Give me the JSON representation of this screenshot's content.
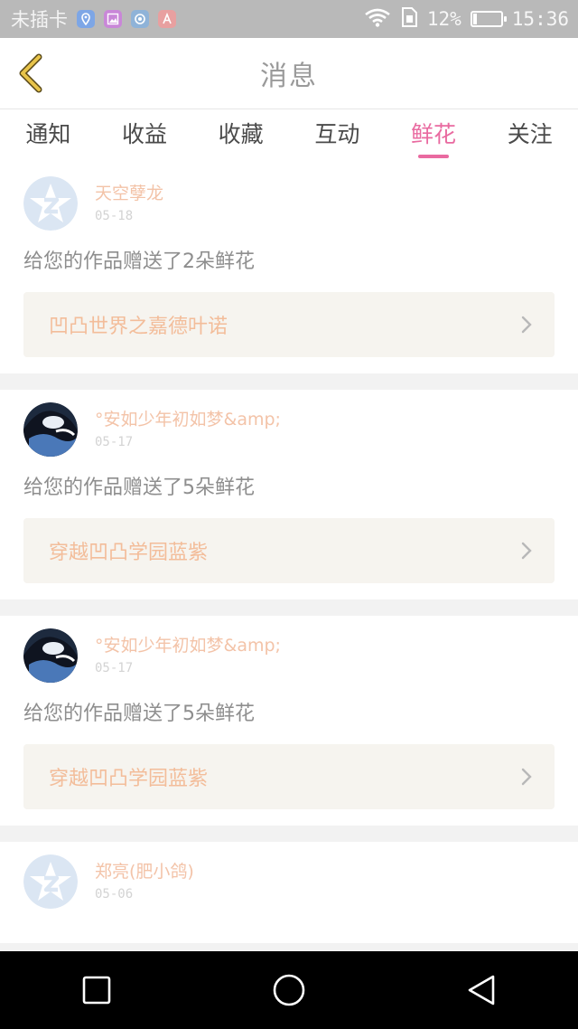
{
  "status_bar": {
    "carrier": "未插卡",
    "battery_percent": "12%",
    "battery_level": 0.12,
    "time": "15:36",
    "icons": [
      "location-icon",
      "gallery-icon",
      "app-icon",
      "app-icon-a"
    ]
  },
  "header": {
    "title": "消息",
    "back_icon": "chevron-left-icon"
  },
  "tabs": [
    {
      "label": "通知",
      "active": false
    },
    {
      "label": "收益",
      "active": false
    },
    {
      "label": "收藏",
      "active": false
    },
    {
      "label": "互动",
      "active": false
    },
    {
      "label": "鲜花",
      "active": true
    },
    {
      "label": "关注",
      "active": false
    }
  ],
  "feed": [
    {
      "username": "天空孽龙",
      "date": "05-18",
      "avatar": "default-avatar-icon",
      "message": "给您的作品赠送了2朵鲜花",
      "work_title": "凹凸世界之嘉德叶诺"
    },
    {
      "username": "°安如少年初如梦&amp;",
      "date": "05-17",
      "avatar": "photo-avatar",
      "message": "给您的作品赠送了5朵鲜花",
      "work_title": "穿越凹凸学园蓝紫"
    },
    {
      "username": "°安如少年初如梦&amp;",
      "date": "05-17",
      "avatar": "photo-avatar",
      "message": "给您的作品赠送了5朵鲜花",
      "work_title": "穿越凹凸学园蓝紫"
    },
    {
      "username": "郑亮(肥小鸽)",
      "date": "05-06",
      "avatar": "default-avatar-icon",
      "message": "",
      "work_title": ""
    }
  ],
  "colors": {
    "accent": "#e96aa0",
    "username": "#f3c3a8",
    "work_title": "#f3bd9a",
    "back_chevron": "#e8c44a"
  }
}
